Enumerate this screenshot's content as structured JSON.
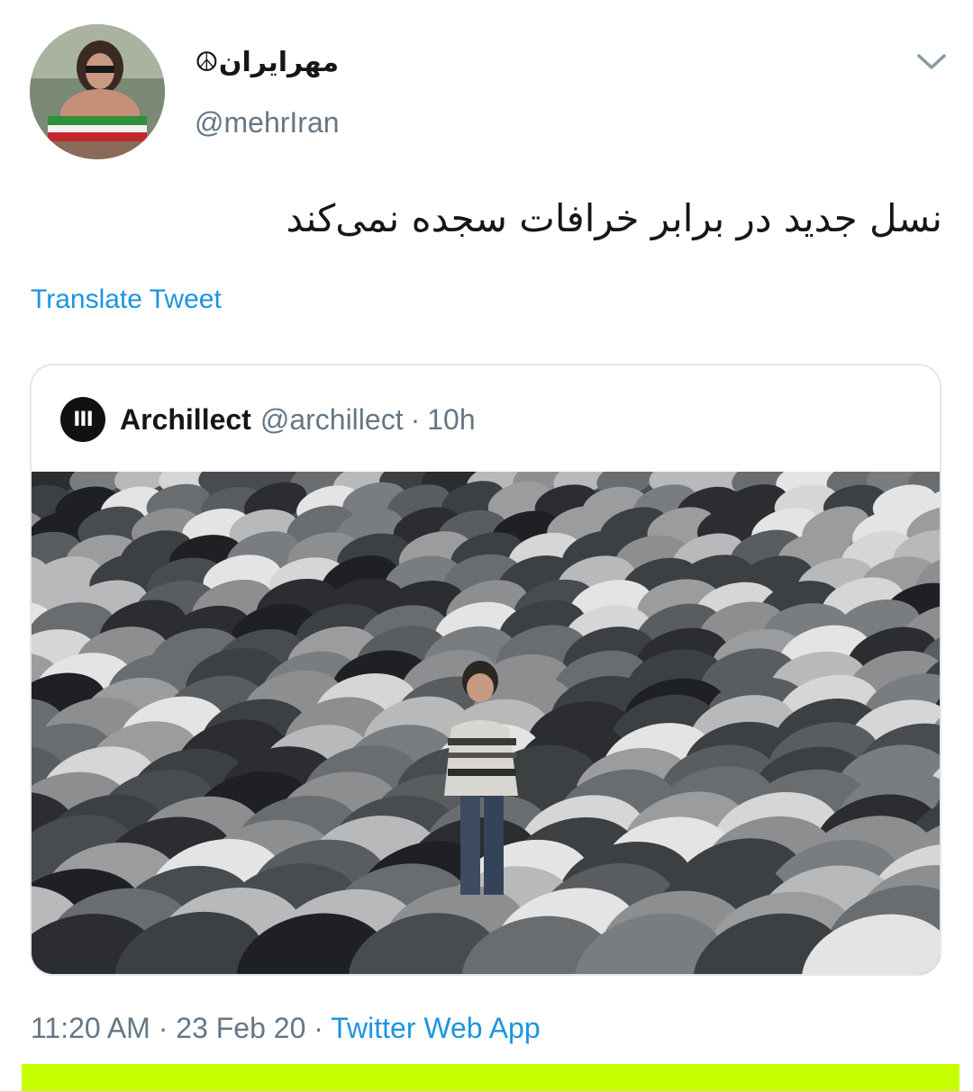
{
  "tweet": {
    "display_name": "☮مهرايران",
    "handle": "@mehrIran",
    "text": "نسل جدید در برابر خرافات سجده نمی‌کند",
    "translate_label": "Translate Tweet",
    "time": "11:20 AM",
    "date": "23 Feb 20",
    "separator": "·",
    "source": "Twitter Web App"
  },
  "quoted": {
    "avatar_glyph": "III",
    "name": "Archillect",
    "handle": "@archillect",
    "separator": "·",
    "age": "10h"
  },
  "icons": {
    "menu": "chevron-down-icon"
  },
  "colors": {
    "link": "#1b95e0",
    "secondary": "#657786",
    "border": "#e1e8ed",
    "highlight_bar": "#c6ff00"
  }
}
